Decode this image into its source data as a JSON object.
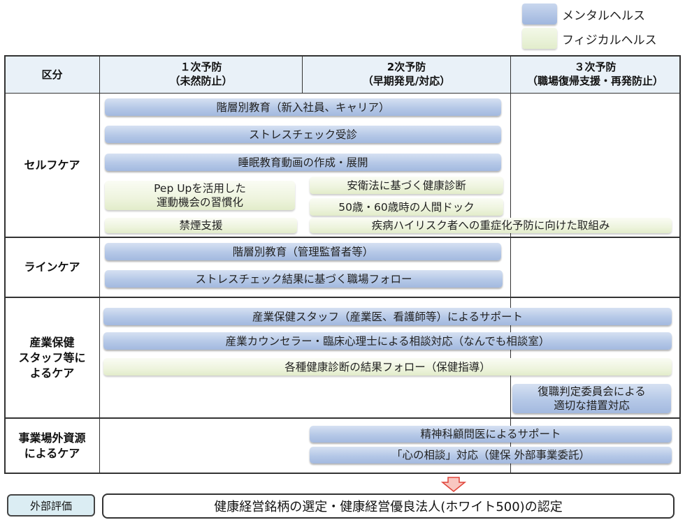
{
  "legend": {
    "mental": "メンタルヘルス",
    "physical": "フィジカルヘルス"
  },
  "header": {
    "category": "区分",
    "primary_line1": "１次予防",
    "primary_line2": "（未然防止）",
    "secondary_line1": "2次予防",
    "secondary_line2": "（早期発見/対応）",
    "tertiary_line1": "３次予防",
    "tertiary_line2": "（職場復帰支援・再発防止）"
  },
  "rows": {
    "self_care": "セルフケア",
    "line_care": "ラインケア",
    "staff_care_1": "産業保健",
    "staff_care_2": "スタッフ等に",
    "staff_care_3": "よるケア",
    "external_1": "事業場外資源",
    "external_2": "によるケア"
  },
  "bars": {
    "tiered_new": "階層別教育（新入社員、キャリア）",
    "stress_check": "ストレスチェック受診",
    "sleep_video": "睡眠教育動画の作成・展開",
    "pepup_1": "Pep Upを活用した",
    "pepup_2": "運動機会の習慣化",
    "health_law": "安衛法に基づく健康診断",
    "dock": "50歳・60歳時の人間ドック",
    "smoking": "禁煙支援",
    "high_risk": "疾病ハイリスク者への重症化予防に向けた取組み",
    "tiered_mgr": "階層別教育（管理監督者等）",
    "stress_follow": "ストレスチェック結果に基づく職場フォロー",
    "staff_support": "産業保健スタッフ（産業医、看護師等）によるサポート",
    "counselor": "産業カウンセラー・臨床心理士による相談対応（なんでも相談室）",
    "checkup_follow": "各種健康診断の結果フォロー（保健指導）",
    "return_1": "復職判定委員会による",
    "return_2": "適切な措置対応",
    "psychiatrist": "精神科顧問医によるサポート",
    "kokoro": "「心の相談」対応（健保 外部事業委託）"
  },
  "external_eval": {
    "label": "外部評価",
    "text": "健康経営銘柄の選定・健康経営優良法人(ホワイト500)の認定"
  },
  "colors": {
    "mental": "#b5c8e7",
    "physical": "#eef4de",
    "header_bg": "#e9f1f8",
    "arrow_fill": "#f8c6c0",
    "arrow_stroke": "#e0453a",
    "ext_label_bg": "#dbedf3"
  }
}
